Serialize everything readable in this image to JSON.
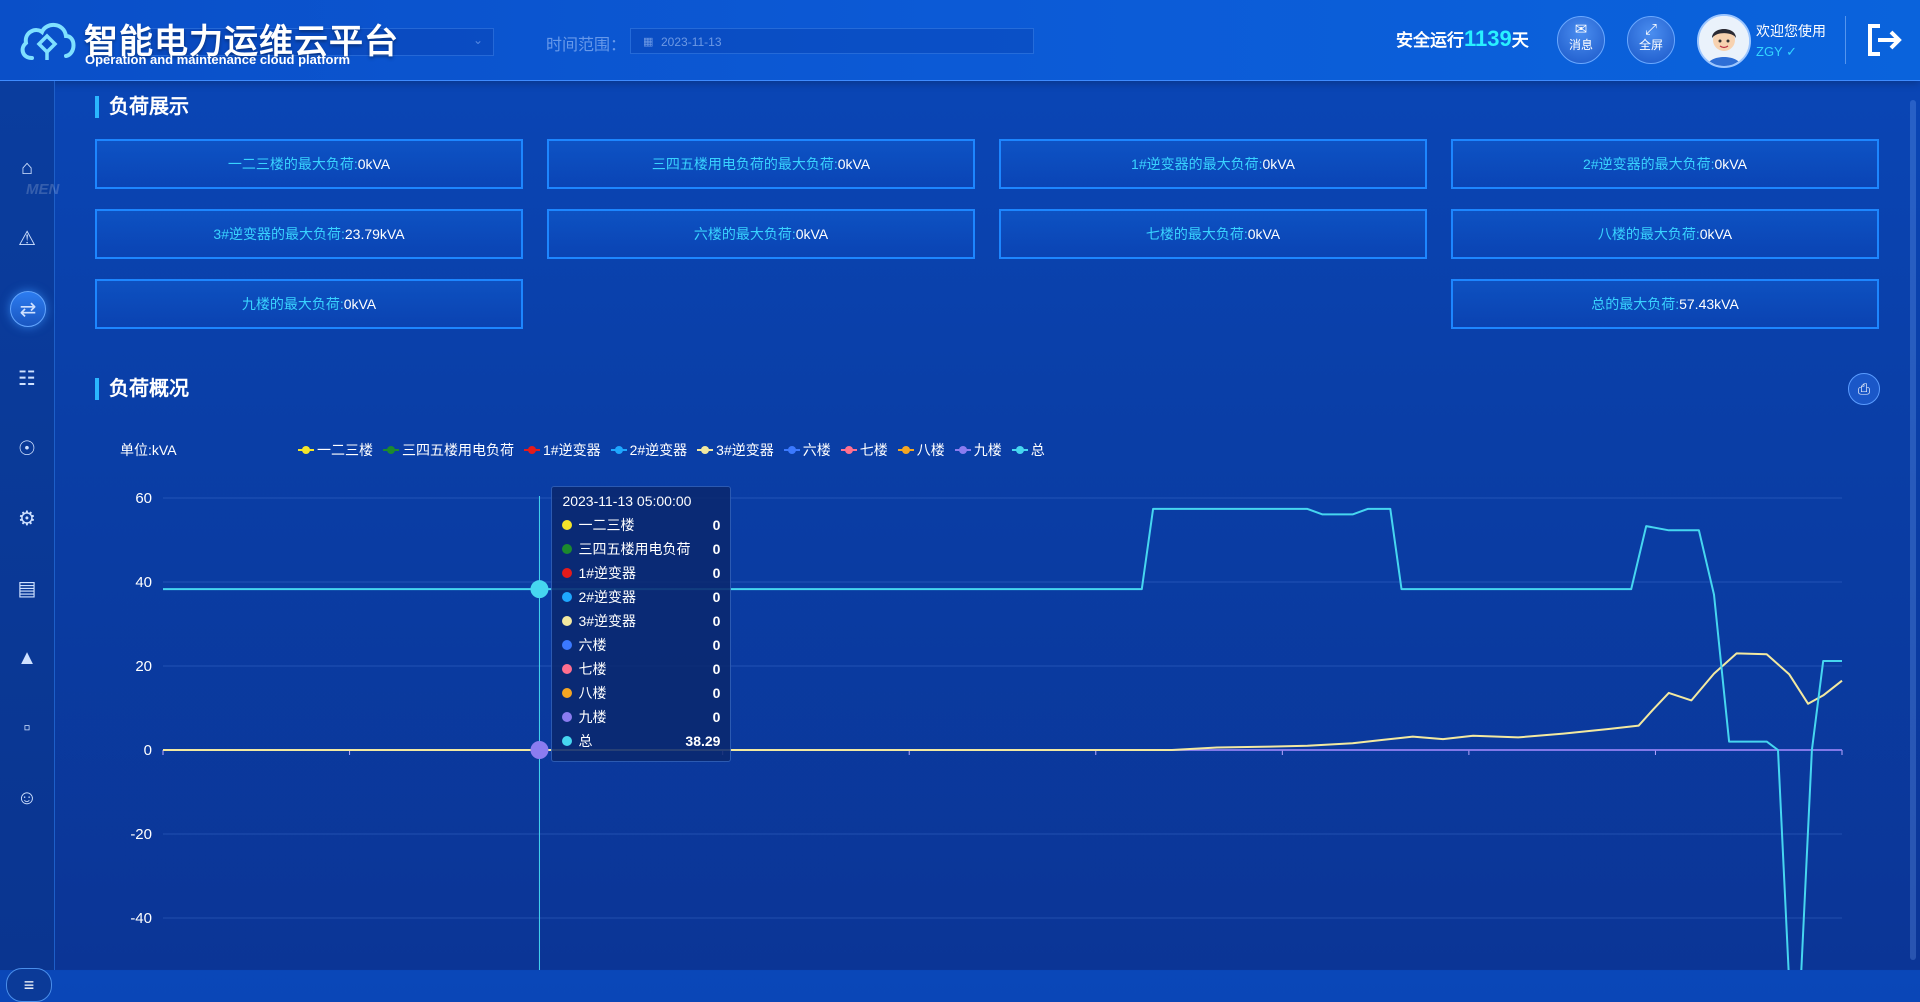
{
  "header": {
    "title": "智能电力运维云平台",
    "subtitle": "Operation and maintenance cloud platform",
    "time_label": "时间范围：",
    "date_value": "2023-11-13",
    "safe_prefix": "安全运行",
    "safe_days": "1139",
    "safe_suffix": "天",
    "msg_label": "消息",
    "fullscreen_label": "全屏",
    "welcome": "欢迎您使用",
    "username": "ZGY"
  },
  "sidebar": {
    "watermark": "MEN",
    "items": [
      {
        "icon": "home-icon"
      },
      {
        "icon": "monitor-alarm-icon"
      },
      {
        "icon": "load-switch-icon",
        "active": true
      },
      {
        "icon": "topology-icon"
      },
      {
        "icon": "power-gauge-icon"
      },
      {
        "icon": "settings-icon"
      },
      {
        "icon": "report-chart-icon"
      },
      {
        "icon": "alarm-lamp-icon"
      },
      {
        "icon": "statistics-icon"
      },
      {
        "icon": "user-settings-icon"
      }
    ]
  },
  "load_display": {
    "title": "负荷展示",
    "cards": [
      {
        "label": "一二三楼的最大负荷:",
        "value": "0kVA"
      },
      {
        "label": "三四五楼用电负荷的最大负荷:",
        "value": "0kVA"
      },
      {
        "label": "1#逆变器的最大负荷:",
        "value": "0kVA"
      },
      {
        "label": "2#逆变器的最大负荷:",
        "value": "0kVA"
      },
      {
        "label": "3#逆变器的最大负荷:",
        "value": "23.79kVA"
      },
      {
        "label": "六楼的最大负荷:",
        "value": "0kVA"
      },
      {
        "label": "七楼的最大负荷:",
        "value": "0kVA"
      },
      {
        "label": "八楼的最大负荷:",
        "value": "0kVA"
      },
      {
        "label": "九楼的最大负荷:",
        "value": "0kVA"
      },
      {
        "label": "总的最大负荷:",
        "value": "57.43kVA"
      }
    ]
  },
  "overview": {
    "title": "负荷概况"
  },
  "chart_data": {
    "type": "line",
    "unit_label": "单位:kVA",
    "ylim": [
      -50,
      60
    ],
    "yticks": [
      60,
      40,
      20,
      0,
      -20,
      -40
    ],
    "grid": true,
    "legend_position": "top",
    "series": [
      {
        "name": "一二三楼",
        "color": "#f5e52a"
      },
      {
        "name": "三四五楼用电负荷",
        "color": "#1c8a2e"
      },
      {
        "name": "1#逆变器",
        "color": "#e51b1b"
      },
      {
        "name": "2#逆变器",
        "color": "#1ea7ff"
      },
      {
        "name": "3#逆变器",
        "color": "#f3e9a0"
      },
      {
        "name": "六楼",
        "color": "#3b79ff"
      },
      {
        "name": "七楼",
        "color": "#ff6f8f"
      },
      {
        "name": "八楼",
        "color": "#f5a623"
      },
      {
        "name": "九楼",
        "color": "#8b7cf0"
      },
      {
        "name": "总",
        "color": "#46d6f0"
      }
    ],
    "total_points": [
      [
        0,
        38.3
      ],
      [
        5,
        38.3
      ],
      [
        13,
        38.3
      ],
      [
        13.15,
        57.4
      ],
      [
        15.2,
        57.4
      ],
      [
        15.4,
        56.1
      ],
      [
        15.8,
        56.1
      ],
      [
        16,
        57.4
      ],
      [
        16.3,
        57.4
      ],
      [
        16.45,
        38.3
      ],
      [
        19.5,
        38.3
      ],
      [
        19.7,
        53.3
      ],
      [
        20.0,
        52.3
      ],
      [
        20.4,
        52.3
      ],
      [
        20.6,
        37.0
      ],
      [
        20.8,
        2.0
      ],
      [
        21.3,
        2.0
      ],
      [
        21.45,
        0
      ],
      [
        21.6,
        -56
      ],
      [
        21.75,
        -56
      ],
      [
        21.9,
        0
      ],
      [
        22.05,
        21.2
      ],
      [
        22.3,
        21.2
      ]
    ],
    "inverter3_points": [
      [
        0,
        0
      ],
      [
        13.4,
        0
      ],
      [
        14,
        0.6
      ],
      [
        14.7,
        0.8
      ],
      [
        15.2,
        1.0
      ],
      [
        15.8,
        1.6
      ],
      [
        16.2,
        2.4
      ],
      [
        16.6,
        3.2
      ],
      [
        17.0,
        2.6
      ],
      [
        17.4,
        3.4
      ],
      [
        18.0,
        3.0
      ],
      [
        18.6,
        3.9
      ],
      [
        19.2,
        5.0
      ],
      [
        19.6,
        5.8
      ],
      [
        19.8,
        9.8
      ],
      [
        20.0,
        13.6
      ],
      [
        20.3,
        11.8
      ],
      [
        20.6,
        18.2
      ],
      [
        20.9,
        23.0
      ],
      [
        21.3,
        22.8
      ],
      [
        21.6,
        18.0
      ],
      [
        21.85,
        11.0
      ],
      [
        22.05,
        13.0
      ],
      [
        22.3,
        16.5
      ]
    ],
    "x_max": 22.3,
    "tooltip": {
      "time": "2023-11-13 05:00:00",
      "x": 5,
      "values": [
        "0",
        "0",
        "0",
        "0",
        "0",
        "0",
        "0",
        "0",
        "0",
        "38.29"
      ]
    }
  }
}
